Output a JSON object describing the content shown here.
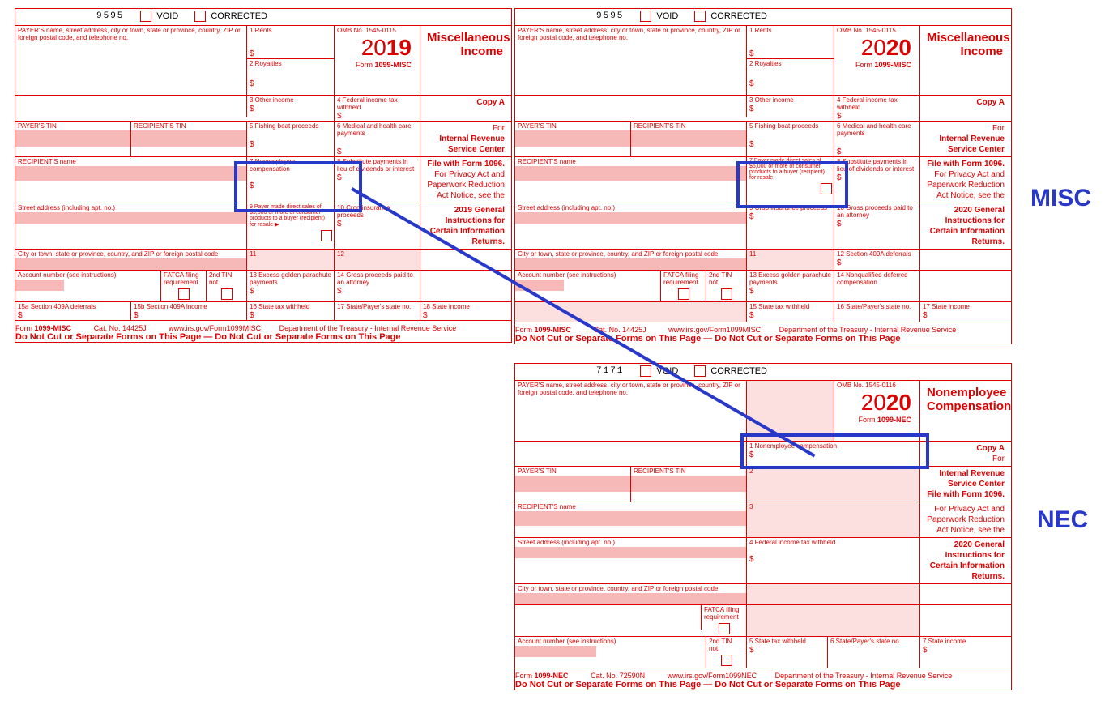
{
  "common": {
    "void": "VOID",
    "corrected": "CORRECTED",
    "payer_name_label": "PAYER'S name, street address, city or town, state or province, country, ZIP or foreign postal code, and telephone no.",
    "omb": "OMB No. 1545-0115",
    "omb_nec": "OMB No. 1545-0116",
    "form_misc": "1099-MISC",
    "form_nec": "1099-NEC",
    "form_label": "Form",
    "payer_tin": "PAYER'S TIN",
    "recipient_tin": "RECIPIENT'S TIN",
    "recipient_name": "RECIPIENT'S name",
    "street": "Street address (including apt. no.)",
    "city": "City or town, state or province, country, and ZIP or foreign postal code",
    "account": "Account number (see instructions)",
    "fatca": "FATCA filing requirement",
    "tin2nd": "2nd TIN not.",
    "copy_a": "Copy A",
    "for": "For",
    "irsc": "Internal Revenue Service Center",
    "file_1096": "File with Form 1096.",
    "privacy1": "For Privacy Act and Paperwork Reduction Act Notice, see the",
    "privacy_2019": "2019 General Instructions for Certain Information Returns.",
    "privacy_2020": "2020 General Instructions for Certain Information Returns.",
    "no_cut": "Do Not Cut or Separate Forms on This Page — Do Not Cut or Separate Forms on This Page",
    "no_cut_nec": "Do Not Cut or Separate Forms on This Page   —   Do Not Cut or Separate Forms on This Page",
    "dept": "Department of the Treasury - Internal Revenue Service",
    "url_misc": "www.irs.gov/Form1099MISC",
    "url_nec": "www.irs.gov/Form1099NEC",
    "cat_misc": "Cat. No. 14425J",
    "cat_nec": "Cat. No. 72590N"
  },
  "form2019": {
    "id": "9595",
    "year_thin": "20",
    "year_bold": "19",
    "title1": "Miscellaneous",
    "title2": "Income",
    "box1": "1 Rents",
    "box2": "2 Royalties",
    "box3": "3 Other income",
    "box4": "4 Federal income tax withheld",
    "box5": "5 Fishing boat proceeds",
    "box6": "6 Medical and health care payments",
    "box7": "7 Nonemployee compensation",
    "box8": "8 Substitute payments in lieu of dividends or interest",
    "box9": "9 Payer made direct sales of $5,000 or more of consumer products to a buyer (recipient) for resale ▶",
    "box10": "10 Crop insurance proceeds",
    "box11": "11",
    "box12": "12",
    "box13": "13 Excess golden parachute payments",
    "box14": "14 Gross proceeds paid to an attorney",
    "box15a": "15a Section 409A deferrals",
    "box15b": "15b Section 409A income",
    "box16": "16 State tax withheld",
    "box17": "17 State/Payer's state no.",
    "box18": "18 State income"
  },
  "form2020misc": {
    "id": "9595",
    "year_thin": "20",
    "year_bold": "20",
    "title1": "Miscellaneous",
    "title2": "Income",
    "box1": "1 Rents",
    "box2": "2 Royalties",
    "box3": "3 Other income",
    "box4": "4 Federal income tax withheld",
    "box5": "5 Fishing boat proceeds",
    "box6": "6 Medical and health care payments",
    "box7": "7 Payer made direct sales of $5,000 or more of consumer products to a buyer (recipient) for resale",
    "box8": "8 Substitute payments in lieu of dividends or interest",
    "box9": "9 Crop insurance proceeds",
    "box10": "10 Gross proceeds paid to an attorney",
    "box11": "11",
    "box12": "12 Section 409A deferrals",
    "box13": "13 Excess golden parachute payments",
    "box14": "14 Nonqualified deferred compensation",
    "box15": "15 State tax withheld",
    "box16": "16 State/Payer's state no.",
    "box17": "17 State income"
  },
  "form2020nec": {
    "id": "7171",
    "year_thin": "20",
    "year_bold": "20",
    "title1": "Nonemployee",
    "title2": "Compensation",
    "box1": "1  Nonemployee compensation",
    "box2": "2",
    "box3": "3",
    "box4": "4  Federal income tax withheld",
    "box5": "5  State tax withheld",
    "box6": "6  State/Payer's state no.",
    "box7": "7  State income"
  },
  "annotations": {
    "misc": "MISC",
    "nec": "NEC"
  }
}
